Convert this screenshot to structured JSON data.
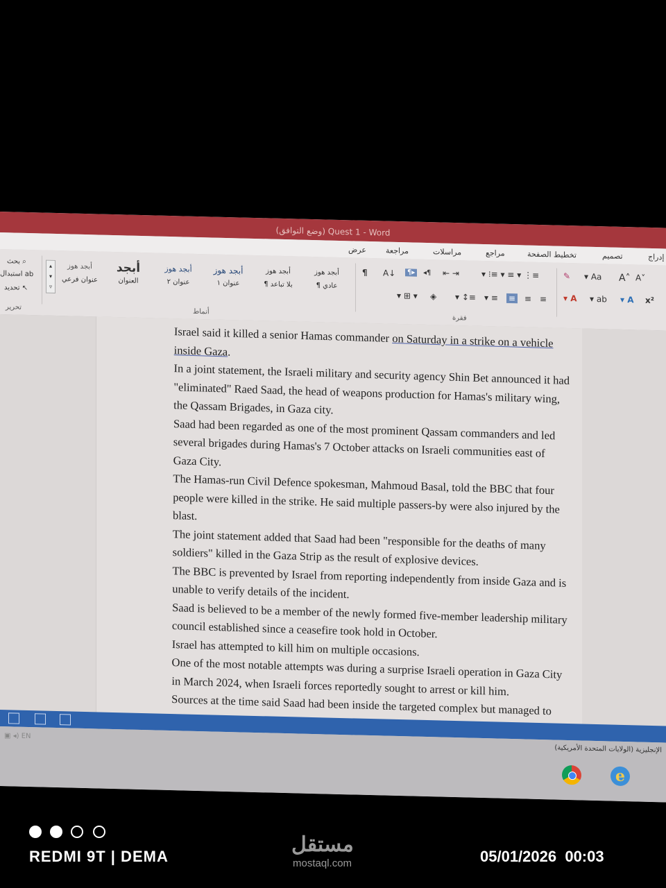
{
  "window": {
    "title": "(وضع التوافق) Quest 1 - Word"
  },
  "tabs": [
    "إدراج",
    "تصميم",
    "تخطيط الصفحة",
    "مراجع",
    "مراسلات",
    "مراجعة",
    "عرض"
  ],
  "ribbon": {
    "styles": [
      {
        "preview": "أبجد هوز",
        "name": "¶ عادي"
      },
      {
        "preview": "أبجد هوز",
        "name": "¶ بلا تباعد"
      },
      {
        "preview": "أبجد هوز",
        "name": "عنوان ١"
      },
      {
        "preview": "أبجد هوز",
        "name": "عنوان ٢"
      },
      {
        "preview": "أبجد",
        "name": "العنوان"
      },
      {
        "preview": "أبجد هوز",
        "name": "عنوان فرعي"
      }
    ],
    "groups": {
      "editing": "تحرير",
      "styles": "أنماط",
      "paragraph": "فقرة"
    },
    "editing": {
      "find": "بحث",
      "replace": "استبدال",
      "select": "تحديد"
    },
    "font_size_label": "Aa"
  },
  "document": {
    "paragraphs": [
      "Israel said it killed a senior Hamas commander on Saturday in a strike on a vehicle inside Gaza.",
      "In a joint statement, the Israeli military and security agency Shin Bet announced it had \"eliminated\" Raed Saad, the head of weapons production for Hamas's military wing, the Qassam Brigades, in Gaza city.",
      "Saad had been regarded as one of the most prominent Qassam commanders and led several brigades during Hamas's 7 October attacks on Israeli communities east of Gaza City.",
      "The Hamas-run Civil Defence spokesman, Mahmoud Basal, told the BBC that four people were killed in the strike. He said multiple passers-by were also injured by the blast.",
      "The joint statement added that Saad had been \"responsible for the deaths of many soldiers\" killed in the Gaza Strip as the result of explosive devices.",
      "The BBC is prevented by Israel from reporting independently from inside Gaza and is unable to verify details of the incident.",
      "Saad is believed to be a member of the newly formed five-member leadership military council established since a ceasefire took hold in October.",
      "Israel has attempted to kill him on multiple occasions.",
      "One of the most notable attempts was during a surprise Israeli operation in Gaza City in March 2024, when Israeli forces reportedly sought to arrest or kill him.",
      "Sources at the time said Saad had been inside the targeted complex but managed to escape moments before the raid."
    ]
  },
  "statusbar": {
    "language": "الإنجليزية (الولايات المتحدة الأمريكية)"
  },
  "taskbar": {
    "lang": "EN"
  },
  "overlay": {
    "device": "REDMI 9T | DEMA",
    "watermark": "مستقل",
    "watermark_url": "mostaql.com",
    "datetime": "05/01/2026  00:03"
  }
}
